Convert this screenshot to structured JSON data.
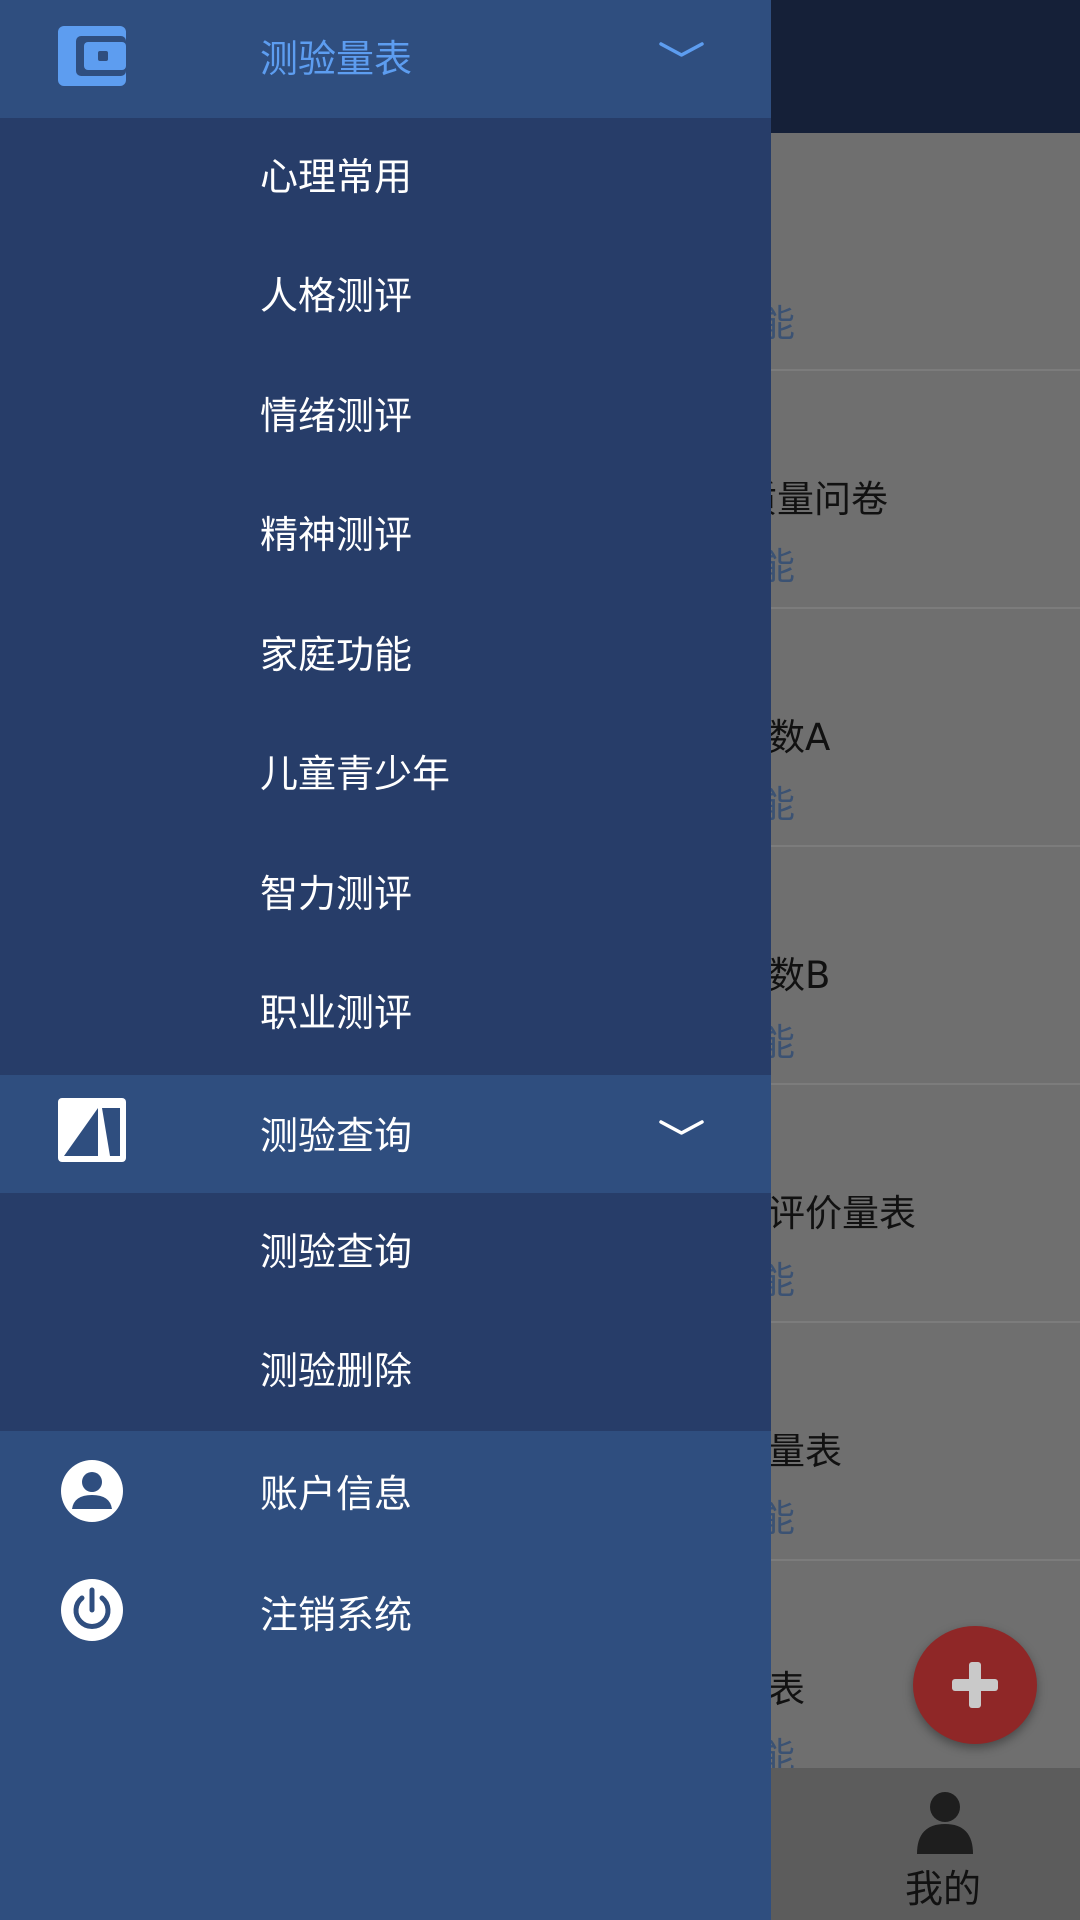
{
  "background": {
    "rows": [
      {
        "title": "",
        "subtitle": "能"
      },
      {
        "title": "质量问卷",
        "subtitle": "能"
      },
      {
        "title": "数A",
        "subtitle": "能"
      },
      {
        "title": "数B",
        "subtitle": "能"
      },
      {
        "title": "评价量表",
        "subtitle": "能"
      },
      {
        "title": "量表",
        "subtitle": "能"
      },
      {
        "title": "表",
        "subtitle": "能"
      }
    ],
    "bottom_tab_label": "我的",
    "fab_icon": "plus-icon"
  },
  "drawer": {
    "section1": {
      "label": "测验量表",
      "icon": "wallet-icon",
      "expanded": true,
      "accent_color": "#5d9df0",
      "items": [
        "心理常用",
        "人格测评",
        "情绪测评",
        "精神测评",
        "家庭功能",
        "儿童青少年",
        "智力测评",
        "职业测评"
      ]
    },
    "section2": {
      "label": "测验查询",
      "icon": "query-icon",
      "expanded": true,
      "items": [
        "测验查询",
        "测验删除"
      ]
    },
    "account": {
      "label": "账户信息",
      "icon": "user-icon"
    },
    "logout": {
      "label": "注销系统",
      "icon": "power-icon"
    }
  }
}
